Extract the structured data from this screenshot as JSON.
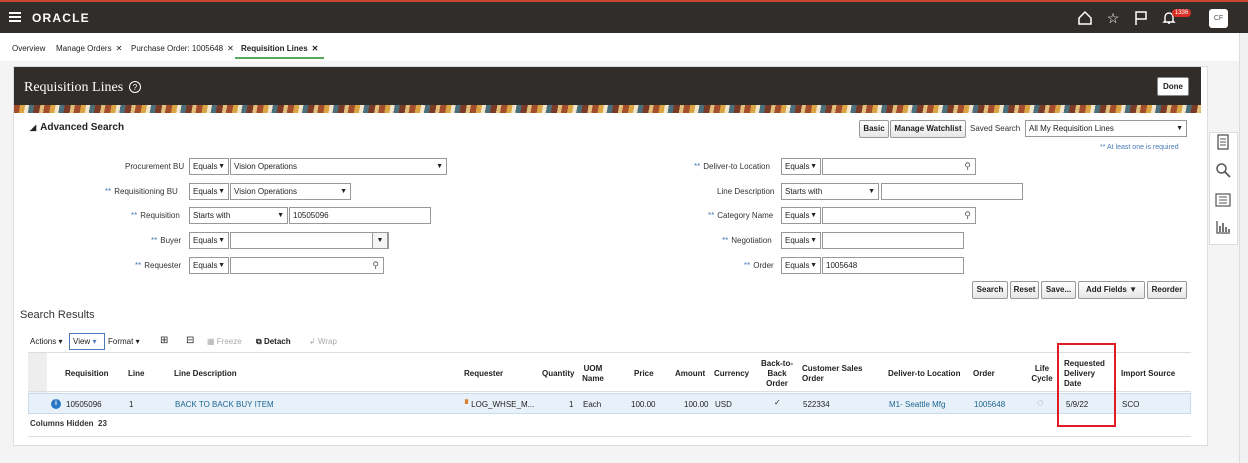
{
  "topbar": {
    "brand": "ORACLE",
    "notification_count": "1336",
    "user_initials": "CF",
    "icons": [
      "hamburger-icon",
      "home-icon",
      "star-icon",
      "flag-icon",
      "bell-icon"
    ]
  },
  "tabs": [
    {
      "label": "Overview",
      "closable": false
    },
    {
      "label": "Manage Orders",
      "closable": true
    },
    {
      "label": "Purchase Order: 1005648",
      "closable": true
    },
    {
      "label": "Requisition Lines",
      "closable": true,
      "active": true
    }
  ],
  "page": {
    "title": "Requisition Lines",
    "done_label": "Done"
  },
  "search": {
    "header": "Advanced Search",
    "basic_label": "Basic",
    "watchlist_label": "Manage Watchlist",
    "saved_search_label": "Saved Search",
    "saved_search_value": "All My Requisition Lines",
    "required_hint": "** At least one is required",
    "required_marker": "**",
    "left_fields": [
      {
        "label": "Procurement BU",
        "required": false,
        "operator": "Equals",
        "value": "Vision Operations"
      },
      {
        "label": "Requisitioning BU",
        "required": true,
        "operator": "Equals",
        "value": "Vision Operations"
      },
      {
        "label": "Requisition",
        "required": true,
        "operator": "Starts with",
        "value": "10505096"
      },
      {
        "label": "Buyer",
        "required": true,
        "operator": "Equals",
        "value": ""
      },
      {
        "label": "Requester",
        "required": true,
        "operator": "Equals",
        "value": ""
      }
    ],
    "right_fields": [
      {
        "label": "Deliver-to Location",
        "required": true,
        "operator": "Equals",
        "value": ""
      },
      {
        "label": "Line Description",
        "required": false,
        "operator": "Starts with",
        "value": ""
      },
      {
        "label": "Category Name",
        "required": true,
        "operator": "Equals",
        "value": ""
      },
      {
        "label": "Negotiation",
        "required": true,
        "operator": "Equals",
        "value": ""
      },
      {
        "label": "Order",
        "required": true,
        "operator": "Equals",
        "value": "1005648"
      }
    ],
    "buttons": [
      "Search",
      "Reset",
      "Save...",
      "Add Fields",
      "Reorder"
    ]
  },
  "results": {
    "title": "Search Results",
    "toolbar": {
      "actions": "Actions",
      "view": "View",
      "format": "Format",
      "freeze": "Freeze",
      "detach": "Detach",
      "wrap": "Wrap"
    },
    "columns": [
      "Requisition",
      "Line",
      "Line Description",
      "Requester",
      "Quantity",
      "UOM Name",
      "Price",
      "Amount",
      "Currency",
      "Back-to-Back Order",
      "Customer Sales Order",
      "Deliver-to Location",
      "Order",
      "Life Cycle",
      "Requested Delivery Date",
      "Import Source"
    ],
    "rows": [
      {
        "requisition": "10505096",
        "line": "1",
        "line_description": "BACK TO BACK BUY ITEM",
        "requester": "LOG_WHSE_M...",
        "quantity": "1",
        "uom": "Each",
        "price": "100.00",
        "amount": "100.00",
        "currency": "USD",
        "back_to_back": "✓",
        "customer_sales_order": "522334",
        "deliver_to": "M1- Seattle Mfg",
        "order": "1005648",
        "requested_delivery_date": "5/9/22",
        "import_source": "SCO"
      }
    ],
    "columns_hidden_label": "Columns Hidden",
    "columns_hidden_count": "23"
  },
  "colors": {
    "topbar": "#312d2a",
    "link": "#1a6690",
    "highlight_box": "#e01b24",
    "selected_row": "#e8f1f9"
  }
}
